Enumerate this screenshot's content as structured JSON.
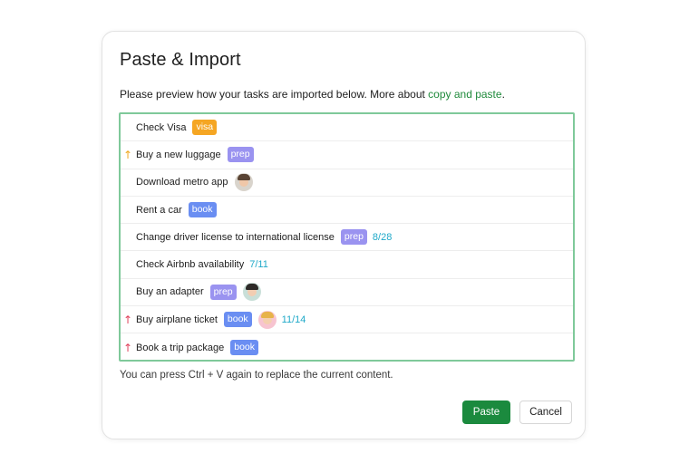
{
  "dialog": {
    "title": "Paste & Import",
    "intro_text": "Please preview how your tasks are imported below. More about ",
    "intro_link": "copy and paste",
    "intro_end": ".",
    "hint": "You can press Ctrl + V again to replace the current content.",
    "paste_label": "Paste",
    "cancel_label": "Cancel"
  },
  "colors": {
    "accent_green": "#1b8a3e",
    "link_green": "#1f8a3b",
    "box_border": "#7fc99a",
    "tag_visa": "#f5a623",
    "tag_prep": "#9a93f0",
    "tag_book": "#6a8ef2",
    "count_color": "#1fa9c9",
    "arrow_medium": "#f0a820",
    "arrow_high": "#e0405a"
  },
  "tasks": [
    {
      "text": "Check Visa",
      "priority_icon": "",
      "tag": "visa",
      "tag_color": "#f5a623",
      "avatar": "",
      "count": ""
    },
    {
      "text": "Buy a new luggage",
      "priority_icon": "↑",
      "priority_color": "#f0a820",
      "tag": "prep",
      "tag_color": "#9a93f0",
      "avatar": "",
      "count": ""
    },
    {
      "text": "Download metro app",
      "priority_icon": "",
      "tag": "",
      "avatar": "man-glasses",
      "count": ""
    },
    {
      "text": "Rent a car",
      "priority_icon": "",
      "tag": "book",
      "tag_color": "#6a8ef2",
      "avatar": "",
      "count": ""
    },
    {
      "text": "Change driver license to international license",
      "priority_icon": "",
      "tag": "prep",
      "tag_color": "#9a93f0",
      "avatar": "",
      "count": "8/28"
    },
    {
      "text": "Check Airbnb availability",
      "priority_icon": "",
      "tag": "",
      "avatar": "",
      "count": "7/11"
    },
    {
      "text": "Buy an adapter",
      "priority_icon": "",
      "tag": "prep",
      "tag_color": "#9a93f0",
      "avatar": "woman-dark-hair",
      "count": ""
    },
    {
      "text": "Buy airplane ticket",
      "priority_icon": "↑",
      "priority_color": "#e0405a",
      "tag": "book",
      "tag_color": "#6a8ef2",
      "avatar": "woman-sunglasses",
      "count": "11/14"
    },
    {
      "text": "Book a trip package",
      "priority_icon": "↑",
      "priority_color": "#e0405a",
      "tag": "book",
      "tag_color": "#6a8ef2",
      "avatar": "",
      "count": ""
    }
  ]
}
